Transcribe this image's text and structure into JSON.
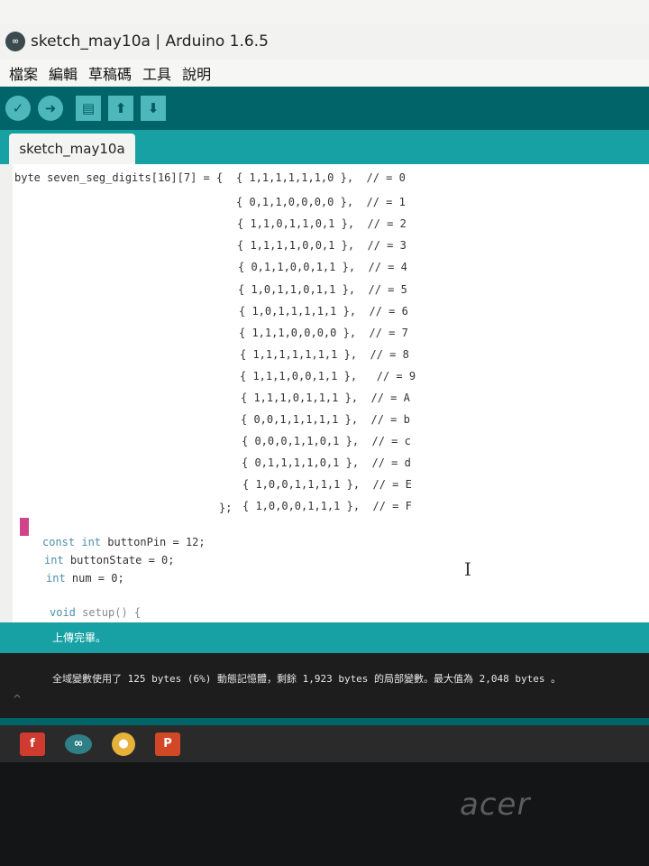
{
  "window": {
    "title": "sketch_may10a | Arduino 1.6.5",
    "logo": "∞"
  },
  "menu": [
    "檔案",
    "編輯",
    "草稿碼",
    "工具",
    "說明"
  ],
  "toolbar": {
    "buttons": [
      {
        "name": "verify-button",
        "icon": "check-icon",
        "glyph": "✓"
      },
      {
        "name": "upload-button",
        "icon": "arrow-right-icon",
        "glyph": "➜"
      },
      {
        "name": "new-button",
        "icon": "new-file-icon",
        "glyph": "▤"
      },
      {
        "name": "open-button",
        "icon": "arrow-up-icon",
        "glyph": "⬆"
      },
      {
        "name": "save-button",
        "icon": "arrow-down-icon",
        "glyph": "⬇"
      }
    ]
  },
  "tab": {
    "label": "sketch_may10a"
  },
  "code": {
    "declaration": "byte seven_seg_digits[16][7] = { ",
    "rows": [
      {
        "values": "{ 1,1,1,1,1,1,0 },",
        "comment": "// = 0"
      },
      {
        "values": "{ 0,1,1,0,0,0,0 },",
        "comment": "// = 1"
      },
      {
        "values": "{ 1,1,0,1,1,0,1 },",
        "comment": "// = 2"
      },
      {
        "values": "{ 1,1,1,1,0,0,1 },",
        "comment": "// = 3"
      },
      {
        "values": "{ 0,1,1,0,0,1,1 },",
        "comment": "// = 4"
      },
      {
        "values": "{ 1,0,1,1,0,1,1 },",
        "comment": "// = 5"
      },
      {
        "values": "{ 1,0,1,1,1,1,1 },",
        "comment": "// = 6"
      },
      {
        "values": "{ 1,1,1,0,0,0,0 },",
        "comment": "// = 7"
      },
      {
        "values": "{ 1,1,1,1,1,1,1 },",
        "comment": "// = 8"
      },
      {
        "values": "{ 1,1,1,0,0,1,1 },",
        "comment": "// = 9"
      },
      {
        "values": "{ 1,1,1,0,1,1,1 },",
        "comment": "// = A"
      },
      {
        "values": "{ 0,0,1,1,1,1,1 },",
        "comment": "// = b"
      },
      {
        "values": "{ 0,0,0,1,1,0,1 },",
        "comment": "// = c"
      },
      {
        "values": "{ 0,1,1,1,1,0,1 },",
        "comment": "// = d"
      },
      {
        "values": "{ 1,0,0,1,1,1,1 },",
        "comment": "// = E"
      },
      {
        "values": "{ 1,0,0,0,1,1,1 },",
        "comment": "// = F"
      }
    ],
    "closing": "};",
    "statements": [
      {
        "keyword": "const int",
        "rest": " buttonPin = 12;"
      },
      {
        "keyword": "int",
        "rest": " buttonState = 0;"
      },
      {
        "keyword": "int",
        "rest": " num = 0;"
      },
      {
        "keyword": "void",
        "rest": " setup() {"
      }
    ]
  },
  "status": {
    "message": "上傳完畢。"
  },
  "console": {
    "message": "全域變數使用了 125 bytes (6%) 動態記憶體，剩餘 1,923 bytes 的局部變數。最大值為 2,048 bytes 。"
  },
  "taskbar": [
    {
      "name": "taskbar-facebook",
      "icon": "facebook-icon",
      "glyph": "f"
    },
    {
      "name": "taskbar-arduino",
      "icon": "arduino-icon",
      "glyph": "∞"
    },
    {
      "name": "taskbar-chrome",
      "icon": "chrome-icon",
      "glyph": "●"
    },
    {
      "name": "taskbar-powerpoint",
      "icon": "powerpoint-icon",
      "glyph": "P"
    }
  ],
  "monitor": {
    "brand": "acer"
  }
}
